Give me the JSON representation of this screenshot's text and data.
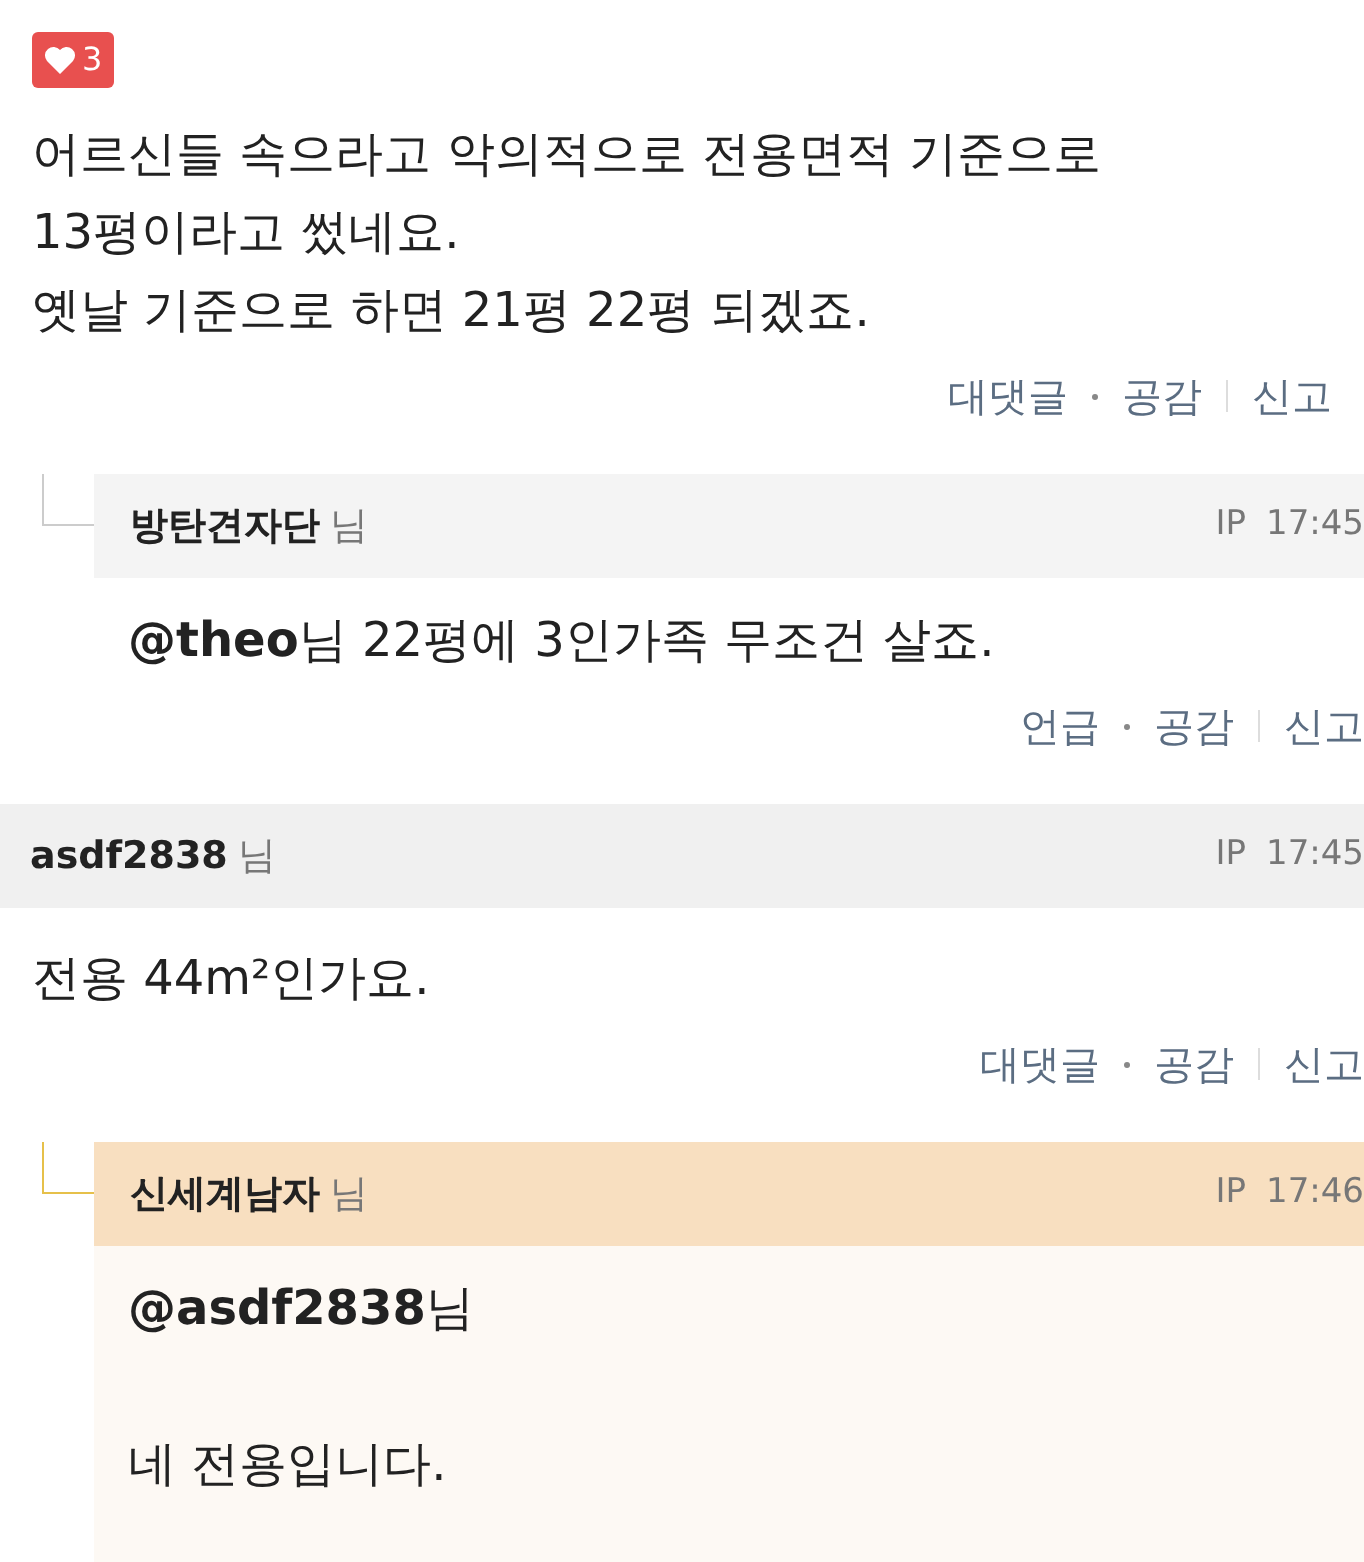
{
  "comments": [
    {
      "kind": "partial",
      "likes": "3",
      "body": [
        "어르신들 속으라고 악의적으로 전용면적 기준으로 13평이라고 썼네요.",
        "옛날 기준으로 하면 21평 22평 되겠죠."
      ],
      "actions": [
        "대댓글",
        "공감",
        "신고"
      ]
    },
    {
      "kind": "reply",
      "highlighted": false,
      "author": "방탄견자단",
      "honorific": "님",
      "ip": "IP",
      "time": "17:45",
      "body": [
        "**@theo**님 22평에 3인가족 무조건 살죠."
      ],
      "actions": [
        "언급",
        "공감",
        "신고"
      ]
    },
    {
      "kind": "root",
      "author": "asdf2838",
      "honorific": "님",
      "ip": "IP",
      "time": "17:45",
      "body": [
        "전용 44m²인가요."
      ],
      "actions": [
        "대댓글",
        "공감",
        "신고"
      ]
    },
    {
      "kind": "reply",
      "highlighted": true,
      "author": "신세계남자",
      "honorific": "님",
      "ip": "IP",
      "time": "17:46",
      "body": [
        "**@asdf2838**님",
        "네 전용입니다."
      ]
    }
  ]
}
